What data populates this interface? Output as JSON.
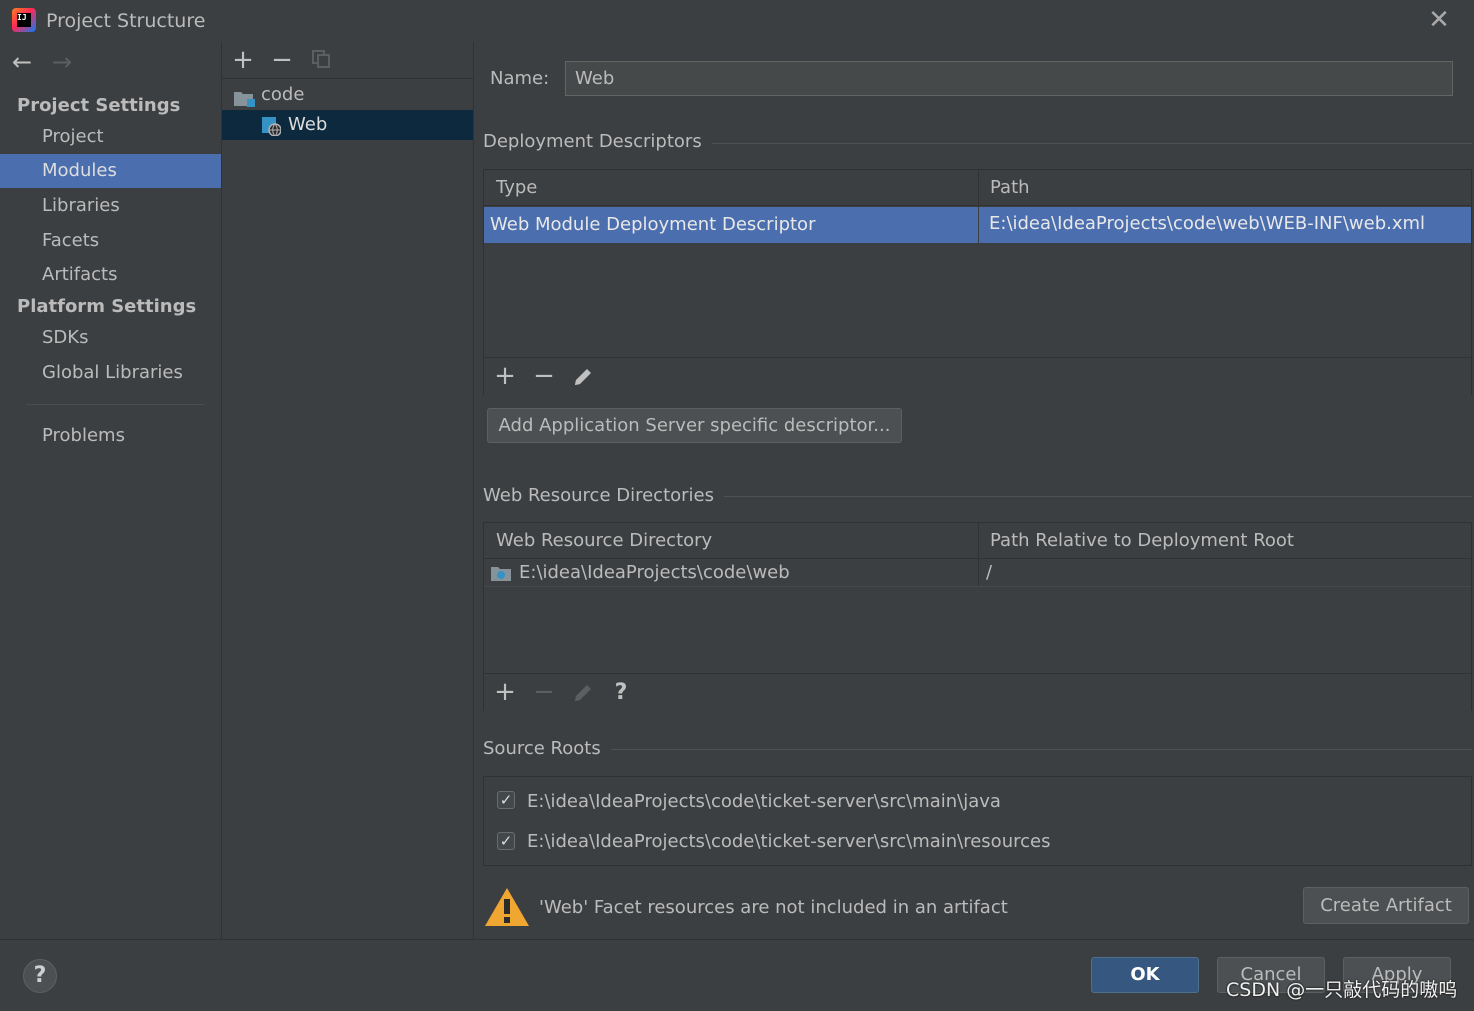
{
  "window": {
    "title": "Project Structure"
  },
  "sidebar": {
    "project_settings_header": "Project Settings",
    "project_items": [
      "Project",
      "Modules",
      "Libraries",
      "Facets",
      "Artifacts"
    ],
    "platform_settings_header": "Platform Settings",
    "platform_items": [
      "SDKs",
      "Global Libraries"
    ],
    "problems": "Problems",
    "selected": "Modules"
  },
  "module_tree": {
    "items": [
      {
        "label": "code",
        "icon": "folder-module-icon"
      },
      {
        "label": "Web",
        "icon": "web-facet-icon",
        "selected": true
      }
    ]
  },
  "main": {
    "name_label": "Name:",
    "name_value": "Web",
    "deployment_descriptors": {
      "title": "Deployment Descriptors",
      "columns": [
        "Type",
        "Path"
      ],
      "rows": [
        {
          "type": "Web Module Deployment Descriptor",
          "path": "E:\\idea\\IdeaProjects\\code\\web\\WEB-INF\\web.xml"
        }
      ],
      "add_server_button": "Add Application Server specific descriptor..."
    },
    "web_resource_directories": {
      "title": "Web Resource Directories",
      "columns": [
        "Web Resource Directory",
        "Path Relative to Deployment Root"
      ],
      "rows": [
        {
          "directory": "E:\\idea\\IdeaProjects\\code\\web",
          "relative_path": "/"
        }
      ]
    },
    "source_roots": {
      "title": "Source Roots",
      "items": [
        {
          "path": "E:\\idea\\IdeaProjects\\code\\ticket-server\\src\\main\\java",
          "checked": true
        },
        {
          "path": "E:\\idea\\IdeaProjects\\code\\ticket-server\\src\\main\\resources",
          "checked": true
        }
      ]
    },
    "warning": {
      "text": "'Web' Facet resources are not included in an artifact",
      "button": "Create Artifact"
    }
  },
  "footer": {
    "ok": "OK",
    "cancel": "Cancel",
    "apply": "Apply",
    "watermark": "CSDN @一只敲代码的嗷呜"
  },
  "colors": {
    "background": "#3c3f41",
    "selection": "#4b6eaf",
    "tree_selection": "#0d293e",
    "ok_button": "#365880",
    "warning": "#f0a732"
  }
}
